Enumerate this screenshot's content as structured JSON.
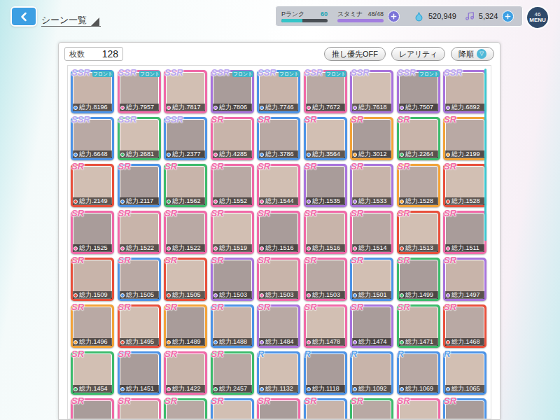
{
  "top_bar": {
    "title": "シーン一覧"
  },
  "status": {
    "rank_label": "Pランク",
    "rank_value": "60",
    "rank_level": 0.45,
    "stamina_label": "スタミナ",
    "stamina_value": "48/48",
    "stamina_level": 1,
    "gems": "520,949",
    "notes": "5,324"
  },
  "menu": {
    "label": "MENU",
    "badge": "46"
  },
  "panel": {
    "count_label": "枚数",
    "count": "128",
    "buttons": [
      {
        "label": "推し優先OFF"
      },
      {
        "label": "レアリティ"
      },
      {
        "label": "降順",
        "icon_text": "▽"
      }
    ]
  },
  "cards": [
    {
      "rarity": "SSR",
      "tag": "フロント",
      "power": "総力.8196",
      "color": "#4d93e6"
    },
    {
      "rarity": "SSR",
      "tag": "フロント",
      "power": "総力.7957",
      "color": "#f06aa8"
    },
    {
      "rarity": "SSR",
      "power": "総力.7817",
      "color": "#f06aa8"
    },
    {
      "rarity": "SSR",
      "tag": "フロント",
      "power": "総力.7806",
      "color": "#a874dc"
    },
    {
      "rarity": "SSR",
      "tag": "フロント",
      "power": "総力.7746",
      "color": "#4d93e6"
    },
    {
      "rarity": "SSR",
      "tag": "フロント",
      "power": "総力.7672",
      "color": "#f06aa8"
    },
    {
      "rarity": "SSR",
      "power": "総力.7618",
      "color": "#a874dc"
    },
    {
      "rarity": "SSR",
      "tag": "フロント",
      "power": "総力.7507",
      "color": "#a874dc"
    },
    {
      "rarity": "SSR",
      "power": "総力.6892",
      "color": "#a874dc"
    },
    {
      "rarity": "SSR",
      "power": "総力.6648",
      "color": "#4d93e6"
    },
    {
      "rarity": "SSR",
      "power": "総力.2681",
      "color": "#3dbb6c"
    },
    {
      "rarity": "SSR",
      "power": "総力.2377",
      "color": "#4d93e6"
    },
    {
      "rarity": "SR",
      "power": "総力.4285",
      "color": "#f06aa8"
    },
    {
      "rarity": "SR",
      "power": "総力.3786",
      "color": "#4d93e6"
    },
    {
      "rarity": "SR",
      "power": "総力.3564",
      "color": "#4d93e6"
    },
    {
      "rarity": "SR",
      "power": "総力.3012",
      "color": "#f2a33a"
    },
    {
      "rarity": "SR",
      "power": "総力.2264",
      "color": "#3dbb6c"
    },
    {
      "rarity": "SR",
      "power": "総力.2199",
      "color": "#f2a33a"
    },
    {
      "rarity": "SR",
      "power": "総力.2149",
      "color": "#e8503c"
    },
    {
      "rarity": "SR",
      "power": "総力.2117",
      "color": "#4d93e6"
    },
    {
      "rarity": "SR",
      "power": "総力.1562",
      "color": "#3dbb6c"
    },
    {
      "rarity": "SR",
      "power": "総力.1552",
      "color": "#f06aa8"
    },
    {
      "rarity": "SR",
      "power": "総力.1544",
      "color": "#f06aa8"
    },
    {
      "rarity": "SR",
      "power": "総力.1535",
      "color": "#a874dc"
    },
    {
      "rarity": "SR",
      "power": "総力.1533",
      "color": "#a874dc"
    },
    {
      "rarity": "SR",
      "power": "総力.1528",
      "color": "#f2a33a"
    },
    {
      "rarity": "SR",
      "power": "総力.1528",
      "color": "#e8503c"
    },
    {
      "rarity": "SR",
      "power": "総力.1525",
      "color": "#f06aa8"
    },
    {
      "rarity": "SR",
      "power": "総力.1522",
      "color": "#f06aa8"
    },
    {
      "rarity": "SR",
      "power": "総力.1522",
      "color": "#f06aa8"
    },
    {
      "rarity": "SR",
      "power": "総力.1519",
      "color": "#f06aa8"
    },
    {
      "rarity": "SR",
      "power": "総力.1516",
      "color": "#f06aa8"
    },
    {
      "rarity": "SR",
      "power": "総力.1516",
      "color": "#f06aa8"
    },
    {
      "rarity": "SR",
      "power": "総力.1514",
      "color": "#f06aa8"
    },
    {
      "rarity": "SR",
      "power": "総力.1513",
      "color": "#e8503c"
    },
    {
      "rarity": "SR",
      "power": "総力.1511",
      "color": "#f06aa8"
    },
    {
      "rarity": "SR",
      "power": "総力.1509",
      "color": "#e8503c"
    },
    {
      "rarity": "SR",
      "power": "総力.1505",
      "color": "#4d93e6"
    },
    {
      "rarity": "SR",
      "power": "総力.1505",
      "color": "#e8503c"
    },
    {
      "rarity": "SR",
      "power": "総力.1503",
      "color": "#a874dc"
    },
    {
      "rarity": "SR",
      "power": "総力.1503",
      "color": "#f06aa8"
    },
    {
      "rarity": "SR",
      "power": "総力.1503",
      "color": "#f06aa8"
    },
    {
      "rarity": "SR",
      "power": "総力.1501",
      "color": "#4d93e6"
    },
    {
      "rarity": "SR",
      "power": "総力.1499",
      "color": "#3dbb6c"
    },
    {
      "rarity": "SR",
      "power": "総力.1497",
      "color": "#a874dc"
    },
    {
      "rarity": "SR",
      "power": "総力.1496",
      "color": "#f2a33a"
    },
    {
      "rarity": "SR",
      "power": "総力.1495",
      "color": "#e8503c"
    },
    {
      "rarity": "SR",
      "power": "総力.1489",
      "color": "#f2a33a"
    },
    {
      "rarity": "SR",
      "power": "総力.1488",
      "color": "#4d93e6"
    },
    {
      "rarity": "SR",
      "power": "総力.1484",
      "color": "#a874dc"
    },
    {
      "rarity": "SR",
      "power": "総力.1478",
      "color": "#f06aa8"
    },
    {
      "rarity": "SR",
      "power": "総力.1474",
      "color": "#a874dc"
    },
    {
      "rarity": "SR",
      "power": "総力.1471",
      "color": "#3dbb6c"
    },
    {
      "rarity": "SR",
      "power": "総力.1468",
      "color": "#e8503c"
    },
    {
      "rarity": "SR",
      "power": "総力.1454",
      "color": "#3dbb6c"
    },
    {
      "rarity": "SR",
      "power": "総力.1451",
      "color": "#4d93e6"
    },
    {
      "rarity": "SR",
      "power": "総力.1422",
      "color": "#f06aa8"
    },
    {
      "rarity": "SR",
      "power": "総力.2457",
      "color": "#3dbb6c"
    },
    {
      "rarity": "R",
      "power": "総力.1132",
      "color": "#4d93e6"
    },
    {
      "rarity": "R",
      "power": "総力.1118",
      "color": "#4d93e6"
    },
    {
      "rarity": "R",
      "power": "総力.1092",
      "color": "#4d93e6"
    },
    {
      "rarity": "R",
      "power": "総力.1069",
      "color": "#4d93e6"
    },
    {
      "rarity": "R",
      "power": "総力.1065",
      "color": "#4d93e6"
    },
    {
      "rarity": "SR",
      "color": "#f06aa8"
    },
    {
      "rarity": "SR",
      "color": "#f06aa8"
    },
    {
      "rarity": "SR",
      "color": "#3dbb6c"
    },
    {
      "rarity": "SR",
      "color": "#4d93e6"
    },
    {
      "rarity": "SR",
      "color": "#f06aa8"
    },
    {
      "rarity": "SR",
      "color": "#4d93e6"
    },
    {
      "rarity": "SR",
      "color": "#3dbb6c"
    },
    {
      "rarity": "SR",
      "color": "#f06aa8"
    },
    {
      "rarity": "SR",
      "color": "#4d93e6"
    }
  ]
}
